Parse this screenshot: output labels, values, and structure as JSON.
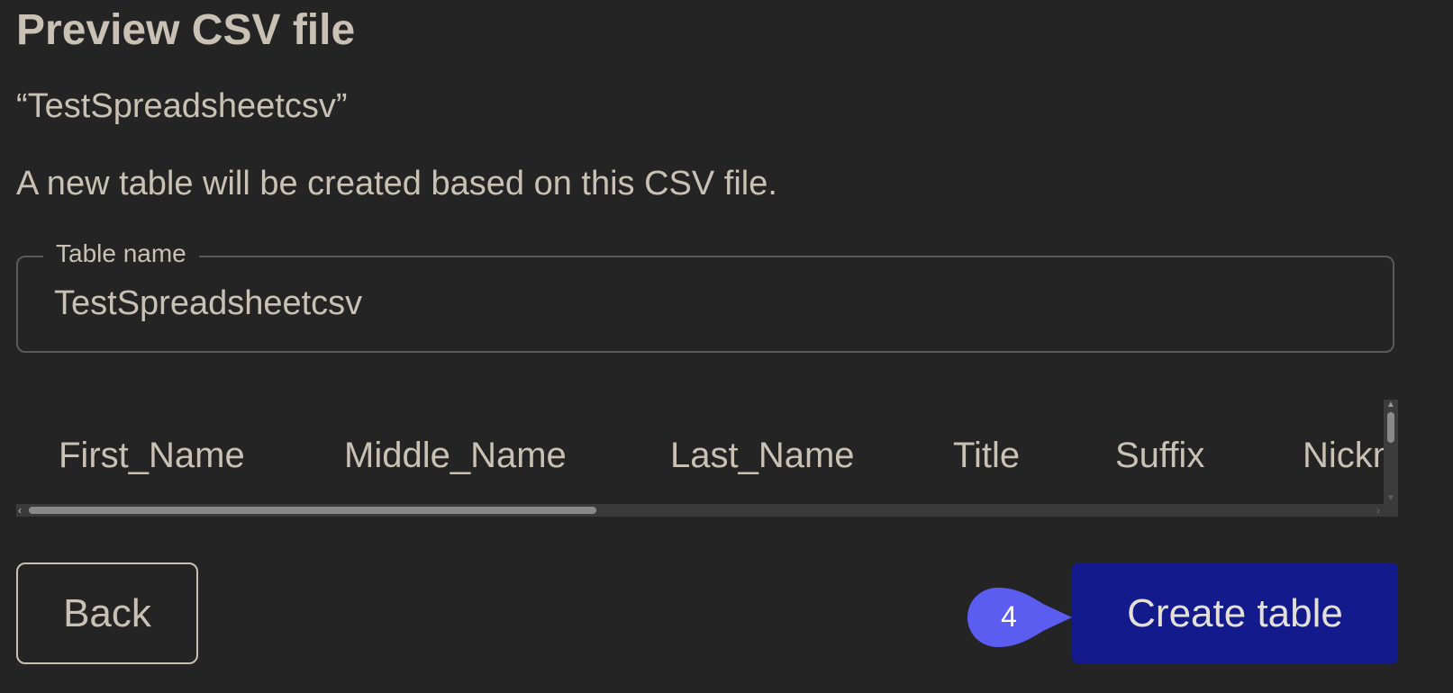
{
  "dialog": {
    "title": "Preview CSV file",
    "filename": "“TestSpreadsheetcsv”",
    "description": "A new table will be created based on this CSV file."
  },
  "table_name_field": {
    "label": "Table name",
    "value": "TestSpreadsheetcsv"
  },
  "preview_table": {
    "columns": [
      "First_Name",
      "Middle_Name",
      "Last_Name",
      "Title",
      "Suffix",
      "Nickname"
    ]
  },
  "buttons": {
    "back_label": "Back",
    "create_label": "Create table"
  },
  "step_marker": {
    "number": "4",
    "color": "#5b5cf0"
  },
  "colors": {
    "background": "#242424",
    "text": "#c9c2b4",
    "primary_button": "#121a8c"
  }
}
